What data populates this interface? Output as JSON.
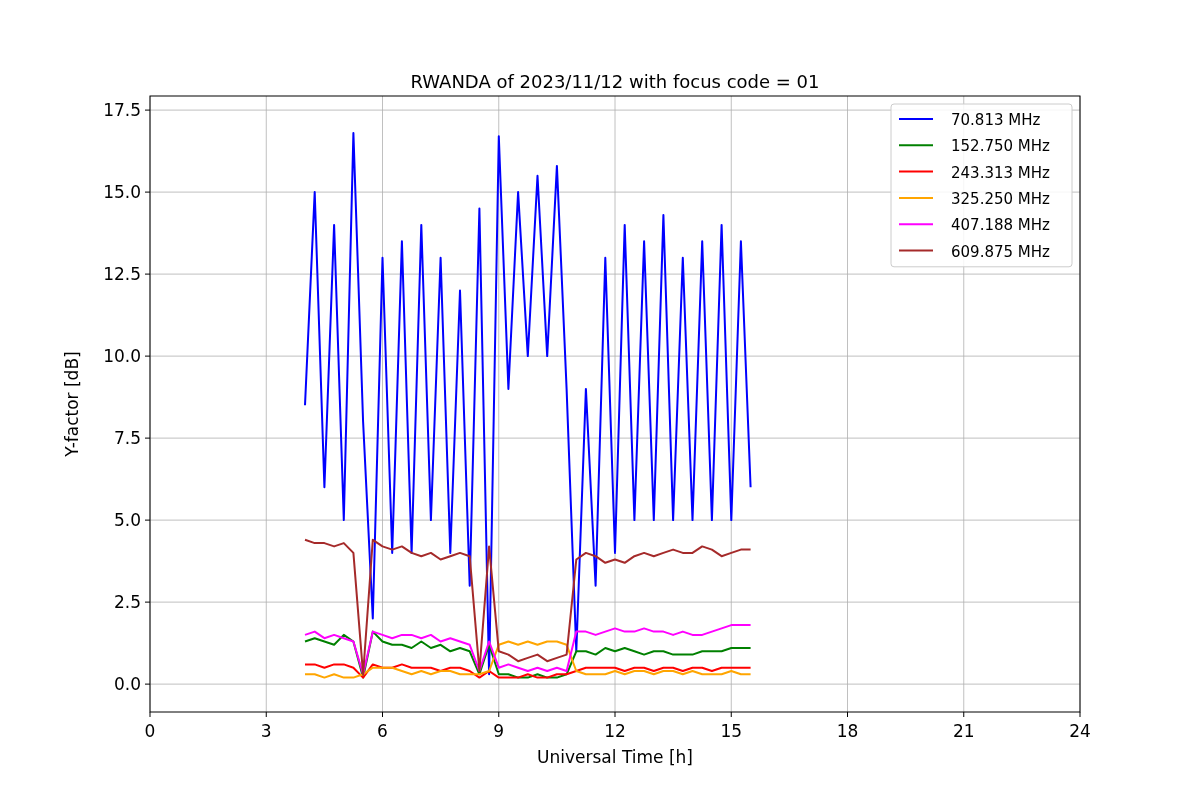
{
  "figure": {
    "chart_data": {
      "type": "line",
      "title": "RWANDA of 2023/11/12 with focus code = 01",
      "xlabel": "Universal Time [h]",
      "ylabel": "Y-factor [dB]",
      "x": [
        4.0,
        4.25,
        4.5,
        4.75,
        5.0,
        5.25,
        5.5,
        5.75,
        6.0,
        6.25,
        6.5,
        6.75,
        7.0,
        7.25,
        7.5,
        7.75,
        8.0,
        8.25,
        8.5,
        8.75,
        9.0,
        9.25,
        9.5,
        9.75,
        10.0,
        10.25,
        10.5,
        10.75,
        11.0,
        11.25,
        11.5,
        11.75,
        12.0,
        12.25,
        12.5,
        12.75,
        13.0,
        13.25,
        13.5,
        13.75,
        14.0,
        14.25,
        14.5,
        14.75,
        15.0,
        15.25,
        15.5
      ],
      "series": [
        {
          "name": "70.813 MHz",
          "color": "#0000ff",
          "values": [
            8.5,
            15,
            6,
            14,
            5,
            16.8,
            8,
            2,
            13,
            4,
            13.5,
            4,
            14,
            5,
            13,
            4,
            12,
            3,
            14.5,
            0.3,
            16.7,
            9,
            15,
            10,
            15.5,
            10,
            15.8,
            9,
            1,
            9,
            3,
            13,
            4,
            14,
            5,
            13.5,
            5,
            14.3,
            5,
            13,
            5,
            13.5,
            5,
            14,
            5,
            13.5,
            6
          ]
        },
        {
          "name": "152.750 MHz",
          "color": "#008000",
          "values": [
            1.3,
            1.4,
            1.3,
            1.2,
            1.5,
            1.3,
            0.2,
            1.6,
            1.3,
            1.2,
            1.2,
            1.1,
            1.3,
            1.1,
            1.2,
            1.0,
            1.1,
            1.0,
            0.3,
            1.2,
            0.3,
            0.3,
            0.2,
            0.2,
            0.3,
            0.2,
            0.2,
            0.3,
            1.0,
            1.0,
            0.9,
            1.1,
            1.0,
            1.1,
            1.0,
            0.9,
            1.0,
            1.0,
            0.9,
            0.9,
            0.9,
            1.0,
            1.0,
            1.0,
            1.1,
            1.1,
            1.1
          ]
        },
        {
          "name": "243.313 MHz",
          "color": "#ff0000",
          "values": [
            0.6,
            0.6,
            0.5,
            0.6,
            0.6,
            0.5,
            0.2,
            0.6,
            0.5,
            0.5,
            0.6,
            0.5,
            0.5,
            0.5,
            0.4,
            0.5,
            0.5,
            0.4,
            0.2,
            0.4,
            0.2,
            0.2,
            0.2,
            0.3,
            0.2,
            0.2,
            0.3,
            0.3,
            0.4,
            0.5,
            0.5,
            0.5,
            0.5,
            0.4,
            0.5,
            0.5,
            0.4,
            0.5,
            0.5,
            0.4,
            0.5,
            0.5,
            0.4,
            0.5,
            0.5,
            0.5,
            0.5
          ]
        },
        {
          "name": "325.250 MHz",
          "color": "#ffa500",
          "values": [
            0.3,
            0.3,
            0.2,
            0.3,
            0.2,
            0.2,
            0.3,
            0.5,
            0.5,
            0.5,
            0.4,
            0.3,
            0.4,
            0.3,
            0.4,
            0.4,
            0.3,
            0.3,
            0.3,
            0.4,
            1.2,
            1.3,
            1.2,
            1.3,
            1.2,
            1.3,
            1.3,
            1.2,
            0.4,
            0.3,
            0.3,
            0.3,
            0.4,
            0.3,
            0.4,
            0.4,
            0.3,
            0.4,
            0.4,
            0.3,
            0.4,
            0.3,
            0.3,
            0.3,
            0.4,
            0.3,
            0.3
          ]
        },
        {
          "name": "407.188 MHz",
          "color": "#ff00ff",
          "values": [
            1.5,
            1.6,
            1.4,
            1.5,
            1.4,
            1.3,
            0.3,
            1.6,
            1.5,
            1.4,
            1.5,
            1.5,
            1.4,
            1.5,
            1.3,
            1.4,
            1.3,
            1.2,
            0.4,
            1.3,
            0.5,
            0.6,
            0.5,
            0.4,
            0.5,
            0.4,
            0.5,
            0.4,
            1.6,
            1.6,
            1.5,
            1.6,
            1.7,
            1.6,
            1.6,
            1.7,
            1.6,
            1.6,
            1.5,
            1.6,
            1.5,
            1.5,
            1.6,
            1.7,
            1.8,
            1.8,
            1.8
          ]
        },
        {
          "name": "609.875 MHz",
          "color": "#a52a2a",
          "values": [
            4.4,
            4.3,
            4.3,
            4.2,
            4.3,
            4.0,
            0.3,
            4.4,
            4.2,
            4.1,
            4.2,
            4.0,
            3.9,
            4.0,
            3.8,
            3.9,
            4.0,
            3.9,
            0.4,
            4.2,
            1.0,
            0.9,
            0.7,
            0.8,
            0.9,
            0.7,
            0.8,
            0.9,
            3.8,
            4.0,
            3.9,
            3.7,
            3.8,
            3.7,
            3.9,
            4.0,
            3.9,
            4.0,
            4.1,
            4.0,
            4.0,
            4.2,
            4.1,
            3.9,
            4.0,
            4.1,
            4.1
          ]
        }
      ],
      "grid": true,
      "legend": true,
      "xlim": [
        0,
        24
      ],
      "ylim": [
        -0.85,
        17.93
      ],
      "xticks": [
        0,
        3,
        6,
        9,
        12,
        15,
        18,
        21,
        24
      ],
      "yticks": [
        {
          "value": 0,
          "label": "0.0"
        },
        {
          "value": 2.5,
          "label": "2.5"
        },
        {
          "value": 5,
          "label": "5.0"
        },
        {
          "value": 7.5,
          "label": "7.5"
        },
        {
          "value": 10,
          "label": "10.0"
        },
        {
          "value": 12.5,
          "label": "12.5"
        },
        {
          "value": 15,
          "label": "15.0"
        },
        {
          "value": 17.5,
          "label": "17.5"
        }
      ]
    }
  }
}
